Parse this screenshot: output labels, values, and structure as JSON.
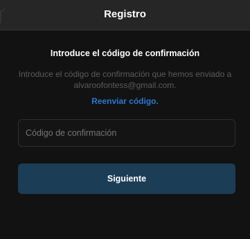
{
  "header": {
    "title": "Registro"
  },
  "main": {
    "heading": "Introduce el código de confirmación",
    "description": "Introduce el código de confirmación que hemos enviado a alvaroofontess@gmail.com.",
    "resend_label": "Reenviar código.",
    "input": {
      "placeholder": "Código de confirmación"
    },
    "next_label": "Siguiente"
  },
  "colors": {
    "background": "#121212",
    "header_background": "#262626",
    "link": "#2b77d2",
    "button": "#1c3d56",
    "muted_text": "#5b5b5b"
  }
}
